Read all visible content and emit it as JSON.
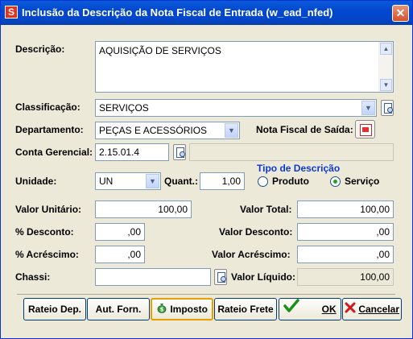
{
  "window": {
    "title": "Inclusão da Descrição da Nota Fiscal de Entrada (w_ead_nfed)",
    "logo_letter": "S",
    "close_glyph": "✕"
  },
  "form": {
    "descricao": {
      "label": "Descrição:",
      "value": "AQUISIÇÃO DE SERVIÇOS"
    },
    "classificacao": {
      "label": "Classificação:",
      "value": "SERVIÇOS"
    },
    "departamento": {
      "label": "Departamento:",
      "value": "PEÇAS E ACESSÓRIOS"
    },
    "nota_fiscal_saida": {
      "label": "Nota Fiscal de Saída:"
    },
    "conta_gerencial": {
      "label": "Conta Gerencial:",
      "value": "2.15.01.4",
      "description": ""
    },
    "unidade": {
      "label": "Unidade:",
      "value": "UN"
    },
    "quant": {
      "label": "Quant.:",
      "value": "1,00"
    },
    "tipo_descricao": {
      "legend": "Tipo de Descrição",
      "options": [
        {
          "label": "Produto",
          "selected": false
        },
        {
          "label": "Serviço",
          "selected": true
        }
      ]
    },
    "valor_unitario": {
      "label": "Valor Unitário:",
      "value": "100,00"
    },
    "valor_total": {
      "label": "Valor Total:",
      "value": "100,00"
    },
    "perc_desconto": {
      "label": "% Desconto:",
      "value": ",00"
    },
    "valor_desconto": {
      "label": "Valor Desconto:",
      "value": ",00"
    },
    "perc_acrescimo": {
      "label": "% Acréscimo:",
      "value": ",00"
    },
    "valor_acrescimo": {
      "label": "Valor Acréscimo:",
      "value": ",00"
    },
    "chassi": {
      "label": "Chassi:",
      "value": ""
    },
    "valor_liquido": {
      "label": "Valor Líquido:",
      "value": "100,00"
    }
  },
  "buttons": {
    "rateio_dep": "Rateio Dep.",
    "aut_forn": "Aut. Forn.",
    "imposto": "Imposto",
    "rateio_frete": "Rateio Frete",
    "ok": "OK",
    "cancelar": "Cancelar"
  },
  "colors": {
    "title_bar": "#0348d0",
    "window_bg": "#ece9d8",
    "legend_blue": "#0a3ad0",
    "close_red": "#d4502a"
  },
  "icons": {
    "logo": "app-logo-icon",
    "close": "close-icon",
    "lookup": "lookup-icon",
    "nota_fiscal": "nota-fiscal-icon",
    "imposto": "money-bag-icon",
    "ok": "checkmark-icon",
    "cancelar": "red-x-icon"
  }
}
